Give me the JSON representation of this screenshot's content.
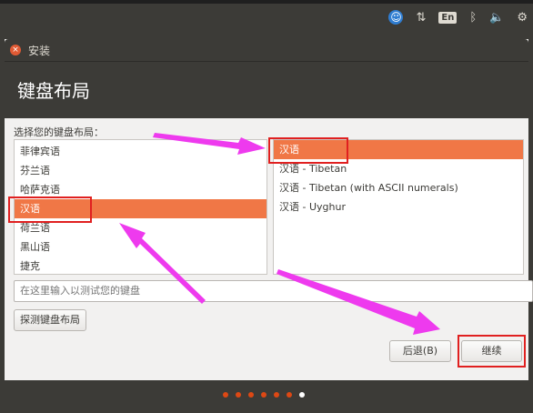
{
  "tray": {
    "accessibility_icon": "accessibility-icon",
    "network_icon": "network-icon",
    "lang_label": "En",
    "bluetooth_icon": "bluetooth-icon",
    "volume_icon": "volume-icon",
    "settings_icon": "settings-gear-icon"
  },
  "window": {
    "title": "安装",
    "close_glyph": "×"
  },
  "page": {
    "title": "键盘布局"
  },
  "layout_prompt": "选择您的键盘布局：",
  "layouts": [
    {
      "label": "菲律宾语"
    },
    {
      "label": "芬兰语"
    },
    {
      "label": "哈萨克语"
    },
    {
      "label": "汉语"
    },
    {
      "label": "荷兰语"
    },
    {
      "label": "黑山语"
    },
    {
      "label": "捷克"
    }
  ],
  "variants": [
    {
      "label": "汉语"
    },
    {
      "label": "汉语 - Tibetan"
    },
    {
      "label": "汉语 - Tibetan (with ASCII numerals)"
    },
    {
      "label": "汉语 - Uyghur"
    }
  ],
  "test_input": {
    "placeholder": "在这里输入以测试您的键盘"
  },
  "buttons": {
    "detect": "探测键盘布局",
    "back": "后退(B)",
    "next": "继续"
  },
  "colors": {
    "selection": "#f07746",
    "annotation": "#ee3aee",
    "highlight_box": "#e02020"
  }
}
